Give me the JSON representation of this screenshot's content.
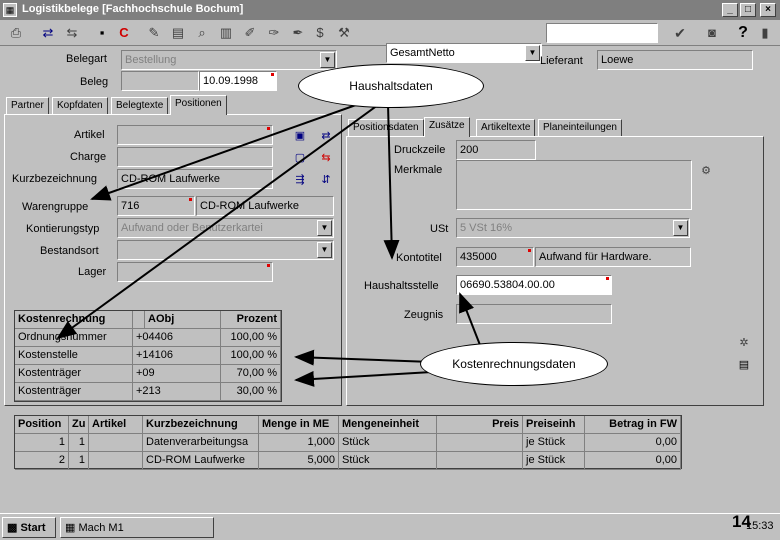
{
  "window": {
    "title": "Logistikbelege [Fachhochschule Bochum]"
  },
  "toolbar": {
    "combo_value": "GesamtNetto",
    "icons": [
      "print-icon",
      "move-icon",
      "move2-icon",
      "save-icon",
      "close-red-icon",
      "edit-icon",
      "book-icon",
      "tool1-icon",
      "tool2-icon",
      "dollar-icon",
      "tool3-icon",
      "check-icon",
      "camera-icon",
      "help-icon",
      "exit-icon"
    ]
  },
  "header": {
    "belegart_label": "Belegart",
    "belegart_value": "Bestellung",
    "beleg_label": "Beleg",
    "beleg_date": "10.09.1998",
    "lieferant_label": "Lieferant",
    "lieferant_value": "Loewe"
  },
  "left_tabs": [
    "Partner",
    "Kopfdaten",
    "Belegtexte",
    "Positionen"
  ],
  "left_form": {
    "artikel": "Artikel",
    "charge": "Charge",
    "kurzbez_label": "Kurzbezeichnung",
    "kurzbez_value": "CD-ROM Laufwerke",
    "warengruppe_label": "Warengruppe",
    "warengruppe_code": "716",
    "warengruppe_text": "CD-ROM Laufwerke",
    "kontierungstyp_label": "Kontierungstyp",
    "kontierungstyp_value": "Aufwand oder Benutzerkartei",
    "bestandsort_label": "Bestandsort",
    "lager_label": "Lager"
  },
  "kostentable": {
    "headers": [
      "Kostenrechnung",
      "AObj",
      "Prozent"
    ],
    "rows": [
      [
        "Ordnungsnummer",
        "+04406",
        "100,00 %"
      ],
      [
        "Kostenstelle",
        "+14106",
        "100,00 %"
      ],
      [
        "Kostenträger",
        "+09",
        "70,00 %"
      ],
      [
        "Kostenträger",
        "+213",
        "30,00 %"
      ]
    ]
  },
  "right_tabs": [
    "Positionsdaten",
    "Zusätze",
    "Artikeltexte",
    "Planeinteilungen"
  ],
  "right_form": {
    "druckzeile_label": "Druckzeile",
    "druckzeile_value": "200",
    "merkmale_label": "Merkmale",
    "ust_label": "USt",
    "ust_value": "5 VSt 16%",
    "kontotitel_label": "Kontotitel",
    "kontotitel_value": "435000",
    "kontotitel_text": "Aufwand für Hardware.",
    "haushaltsstelle_label": "Haushaltsstelle",
    "haushaltsstelle_value": "06690.53804.00.00",
    "zeugnis_label": "Zeugnis"
  },
  "callouts": {
    "haushalt": "Haushaltsdaten",
    "kosten": "Kostenrechnungsdaten"
  },
  "positions": {
    "headers": [
      "Position",
      "Zu",
      "Artikel",
      "Kurzbezeichnung",
      "Menge in ME",
      "Mengeneinheit",
      "Preis",
      "Preiseinh",
      "Betrag in FW"
    ],
    "rows": [
      [
        "1",
        "1",
        "",
        "Datenverarbeitungsa",
        "1,000",
        "Stück",
        "",
        "je Stück",
        "0,00"
      ],
      [
        "2",
        "1",
        "",
        "CD-ROM Laufwerke",
        "5,000",
        "Stück",
        "",
        "je Stück",
        "0,00"
      ]
    ]
  },
  "taskbar": {
    "start": "Start",
    "task": "Mach M1",
    "clock": "15:33",
    "page_number": "14"
  }
}
